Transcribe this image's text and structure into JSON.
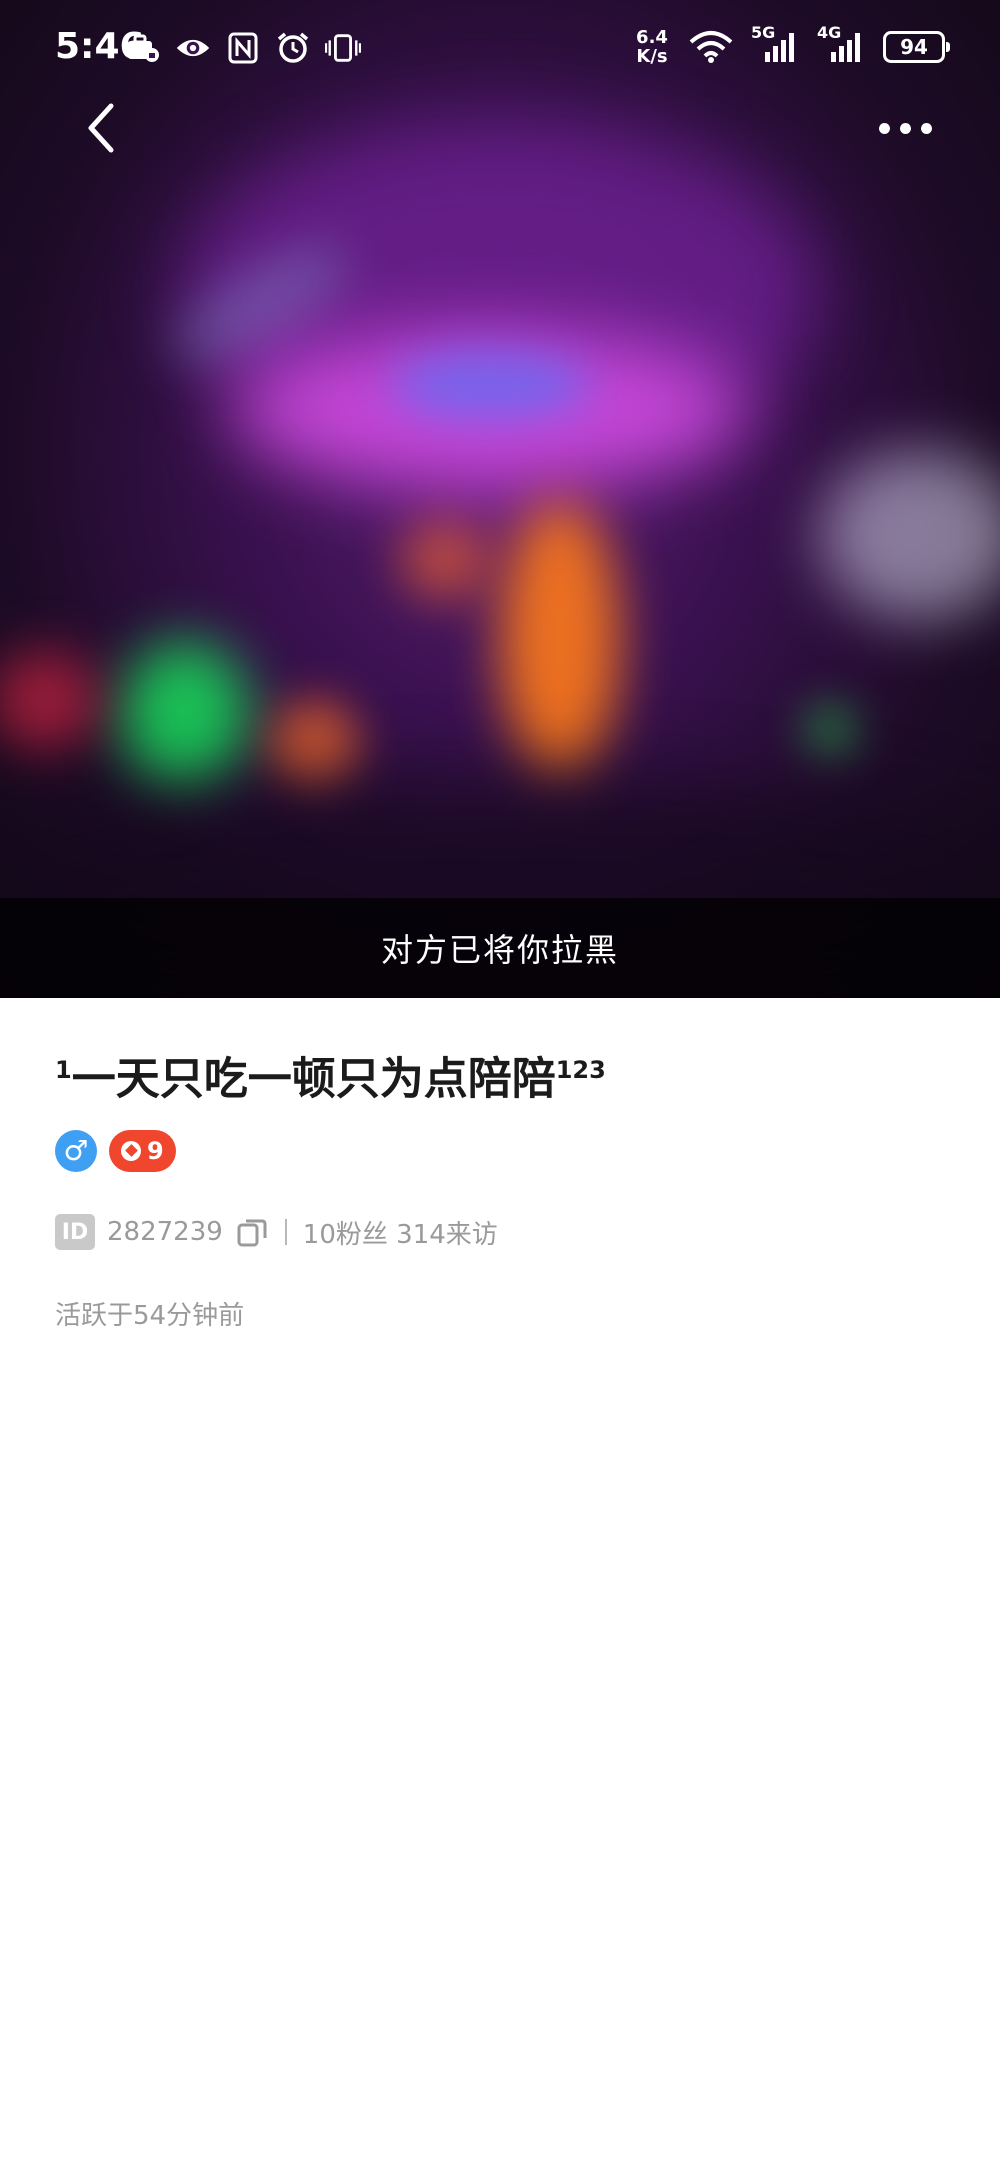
{
  "status_bar": {
    "time": "5:46",
    "network_speed": "6.4 K/s",
    "signal_1": "5G",
    "signal_2": "4G",
    "battery": "94",
    "left_icons": [
      "briefcase-lock-icon",
      "eye-icon",
      "nfc-icon",
      "alarm-icon",
      "vibrate-icon"
    ],
    "right_icons": [
      "wifi-icon",
      "signal-5g-icon",
      "signal-4g-icon",
      "battery-icon"
    ]
  },
  "nav": {
    "back_icon": "chevron-left-icon",
    "more_icon": "more-dots-icon"
  },
  "hero": {
    "blocked_notice": "对方已将你拉黑"
  },
  "profile": {
    "nickname_prefix": "1",
    "nickname_main": "一天只吃一顿只为点陪陪",
    "nickname_suffix": "123",
    "gender_symbol": "♂",
    "level_badge_text": "9",
    "id_label": "ID",
    "id_value": "2827239",
    "stats": "10粉丝 314来访",
    "active_status": "活跃于54分钟前"
  },
  "colors": {
    "gender_badge": "#3f9ff3",
    "level_badge": "#f0462e",
    "secondary_text": "#9a9a9a",
    "nickname_text": "#1b1b1b"
  }
}
